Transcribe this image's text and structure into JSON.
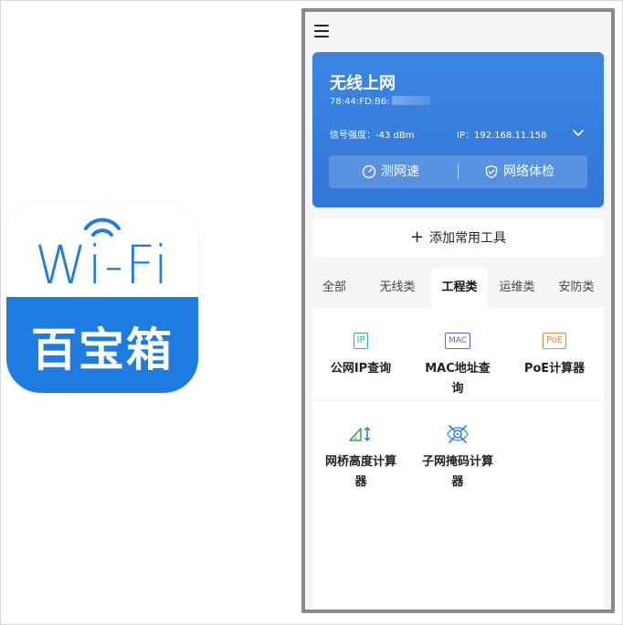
{
  "app_icon": {
    "wifi_text": "Wi-Fi",
    "cn_text": "百宝箱",
    "brand_color": "#1e7be0"
  },
  "header": {
    "menu_icon": "hamburger-menu-icon"
  },
  "wifi_card": {
    "title": "无线上网",
    "mac": "78:44:FD:B6:",
    "signal": "信号强度：-43 dBm",
    "ip": "IP：192.168.11.158",
    "speed_test_label": "测网速",
    "health_check_label": "网络体检",
    "bg_color": "#3478d8"
  },
  "add_tools": {
    "label": "添加常用工具"
  },
  "tabs": [
    {
      "label": "全部"
    },
    {
      "label": "无线类"
    },
    {
      "label": "工程类",
      "active": true
    },
    {
      "label": "运维类"
    },
    {
      "label": "安防类"
    }
  ],
  "tools": [
    {
      "badge": "IP",
      "label": "公网IP查询",
      "color": "#2bb3a4"
    },
    {
      "badge": "MAC",
      "label": "MAC地址查询",
      "color": "#6a5acd"
    },
    {
      "badge": "PoE",
      "label": "PoE计算器",
      "color": "#f08a3c"
    },
    {
      "icon": "bridge-height-icon",
      "label": "网桥高度计算器"
    },
    {
      "icon": "subnet-mask-icon",
      "label": "子网掩码计算器"
    }
  ]
}
